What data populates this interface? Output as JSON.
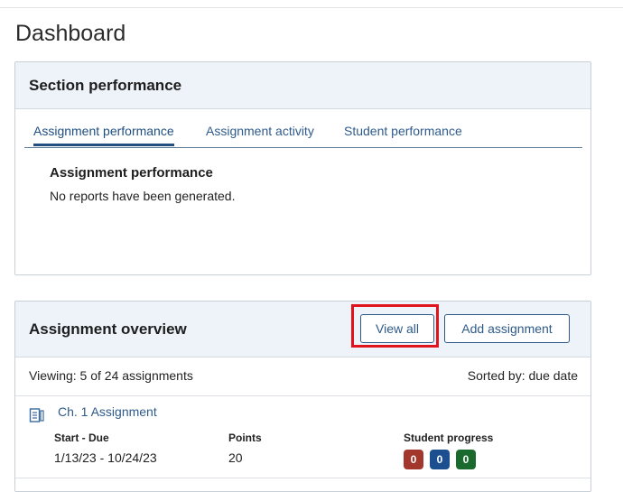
{
  "page": {
    "title": "Dashboard"
  },
  "section_performance": {
    "title": "Section performance",
    "tabs": [
      {
        "label": "Assignment performance",
        "active": true
      },
      {
        "label": "Assignment activity",
        "active": false
      },
      {
        "label": "Student performance",
        "active": false
      }
    ],
    "panel": {
      "heading": "Assignment performance",
      "message": "No reports have been generated."
    }
  },
  "assignment_overview": {
    "title": "Assignment overview",
    "view_all_label": "View all",
    "add_assignment_label": "Add assignment",
    "viewing_text": "Viewing: 5 of 24 assignments",
    "sorted_text": "Sorted by: due date",
    "assignments": [
      {
        "icon": "document-icon",
        "name": "Ch. 1 Assignment",
        "dates_label": "Start - Due",
        "dates": "1/13/23 - 10/24/23",
        "points_label": "Points",
        "points": "20",
        "progress_label": "Student progress",
        "progress": [
          {
            "value": "0",
            "color": "#a3372c"
          },
          {
            "value": "0",
            "color": "#1c4f8f"
          },
          {
            "value": "0",
            "color": "#1a6a2e"
          }
        ]
      }
    ]
  },
  "colors": {
    "accent": "#2f5b8c",
    "highlight": "#e0141c",
    "card_header": "#eef3fa"
  }
}
